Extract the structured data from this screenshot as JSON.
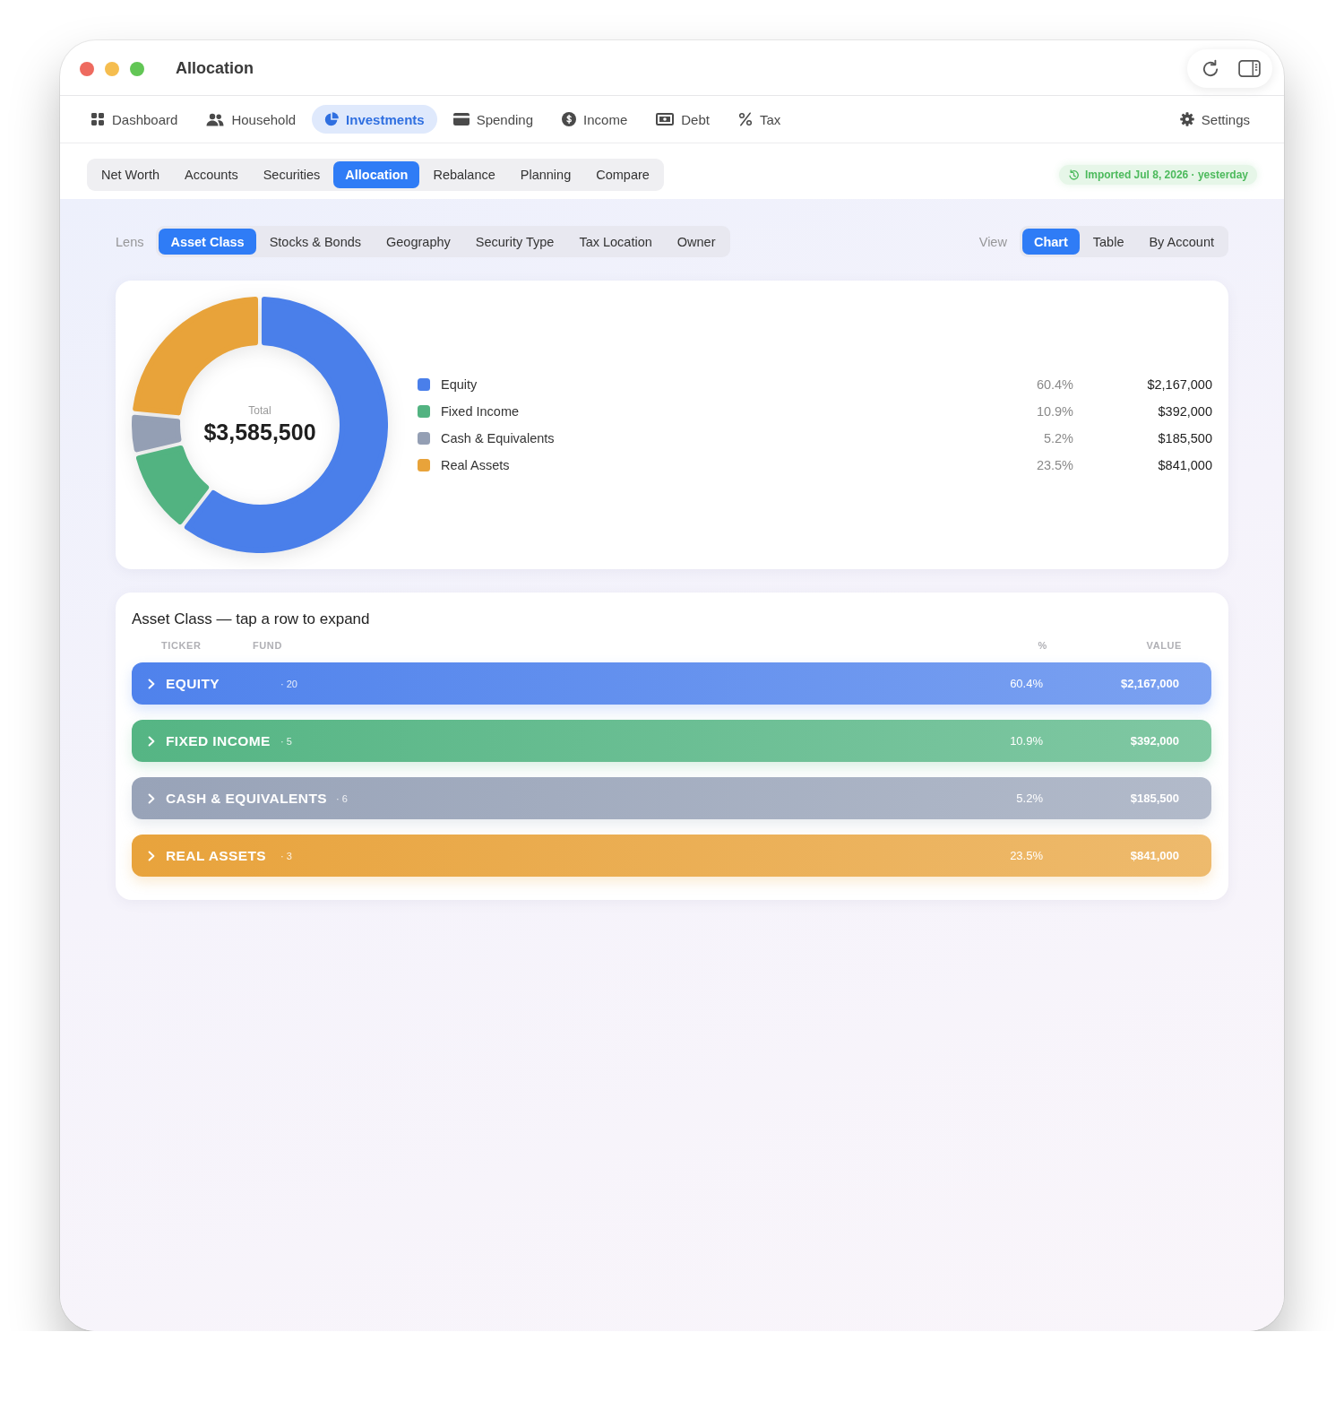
{
  "window": {
    "title": "Allocation"
  },
  "main_nav": {
    "items": [
      {
        "label": "Dashboard",
        "selected": false
      },
      {
        "label": "Household",
        "selected": false
      },
      {
        "label": "Investments",
        "selected": true
      },
      {
        "label": "Spending",
        "selected": false
      },
      {
        "label": "Income",
        "selected": false
      },
      {
        "label": "Debt",
        "selected": false
      },
      {
        "label": "Tax",
        "selected": false
      }
    ],
    "settings": {
      "label": "Settings"
    }
  },
  "section_tabs": [
    {
      "label": "Net Worth",
      "selected": false
    },
    {
      "label": "Accounts",
      "selected": false
    },
    {
      "label": "Securities",
      "selected": false
    },
    {
      "label": "Allocation",
      "selected": true
    },
    {
      "label": "Rebalance",
      "selected": false
    },
    {
      "label": "Planning",
      "selected": false
    },
    {
      "label": "Compare",
      "selected": false
    }
  ],
  "import_badge": {
    "text": "Imported Jul 8, 2026 · yesterday"
  },
  "lens": {
    "label": "Lens",
    "options": [
      {
        "label": "Asset Class",
        "selected": true
      },
      {
        "label": "Stocks & Bonds",
        "selected": false
      },
      {
        "label": "Geography",
        "selected": false
      },
      {
        "label": "Security Type",
        "selected": false
      },
      {
        "label": "Tax Location",
        "selected": false
      },
      {
        "label": "Owner",
        "selected": false
      }
    ]
  },
  "view": {
    "label": "View",
    "options": [
      {
        "label": "Chart",
        "selected": true
      },
      {
        "label": "Table",
        "selected": false
      },
      {
        "label": "By Account",
        "selected": false
      }
    ]
  },
  "allocation_chart": {
    "total_label": "Total",
    "total_value": "$3,585,500",
    "legend": [
      {
        "color": "#4a7fea",
        "percent": "60.4%",
        "value": "$2,167,000"
      },
      {
        "color": "#52b381",
        "percent": "10.9%",
        "value": "$392,000"
      },
      {
        "color": "#949fb4",
        "percent": "5.2%",
        "value": "$185,500"
      },
      {
        "color": "#e8a33a",
        "percent": "23.5%",
        "value": "$841,000"
      }
    ],
    "chart_data": {
      "type": "donut",
      "categories": [
        "Equity",
        "Fixed Income",
        "Cash & Equivalents",
        "Real Assets"
      ],
      "values": [
        60.4,
        10.9,
        5.2,
        23.5
      ]
    }
  },
  "holdings_table": {
    "title": "Asset Class — tap a row to expand",
    "columns": [
      "TICKER",
      "FUND",
      "%",
      "VALUE"
    ],
    "rows": [
      {
        "name": "EQUITY",
        "count": "· 20",
        "percent": "60.4%",
        "value": "$2,167,000",
        "color": "#4f82ec",
        "expanded": false
      },
      {
        "name": "FIXED INCOME",
        "count": "· 5",
        "percent": "10.9%",
        "value": "$392,000",
        "color": "#55b584",
        "expanded": false
      },
      {
        "name": "CASH & EQUIVALENTS",
        "count": "· 6",
        "percent": "5.2%",
        "value": "$185,500",
        "color": "#98a3b8",
        "expanded": false
      },
      {
        "name": "REAL ASSETS",
        "count": "· 3",
        "percent": "23.5%",
        "value": "$841,000",
        "color": "#e8a33c",
        "expanded": false
      }
    ]
  }
}
